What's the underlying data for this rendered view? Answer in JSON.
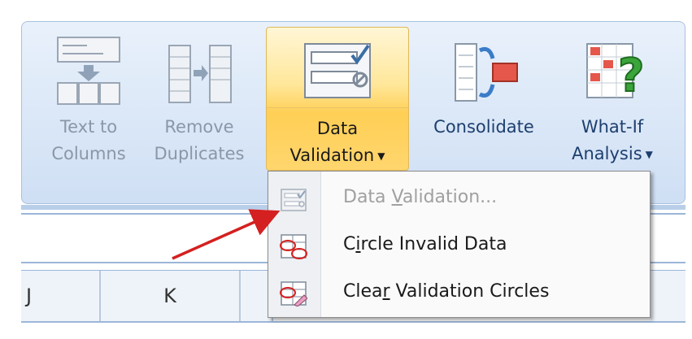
{
  "ribbon": {
    "buttons": [
      {
        "line1": "Text to",
        "line2": "Columns",
        "enabled": false
      },
      {
        "line1": "Remove",
        "line2": "Duplicates",
        "enabled": false
      },
      {
        "line1": "Data",
        "line2": "Validation",
        "enabled": true
      },
      {
        "line1": "Consolidate",
        "line2": "",
        "enabled": true
      },
      {
        "line1": "What-If",
        "line2": "Analysis",
        "enabled": true
      }
    ],
    "dropdown_caret": "▼"
  },
  "grid": {
    "columns": [
      "J",
      "K"
    ]
  },
  "menu": {
    "items": [
      {
        "prefix": "Data ",
        "accel": "V",
        "suffix": "alidation...",
        "enabled": false
      },
      {
        "prefix": "C",
        "accel": "i",
        "suffix": "rcle Invalid Data",
        "enabled": true
      },
      {
        "prefix": "Clea",
        "accel": "r",
        "suffix": " Validation Circles",
        "enabled": true
      }
    ]
  },
  "colors": {
    "ribbon_bg": "#dde9f8",
    "highlight": "#ffd66e",
    "arrow": "#d42020"
  }
}
